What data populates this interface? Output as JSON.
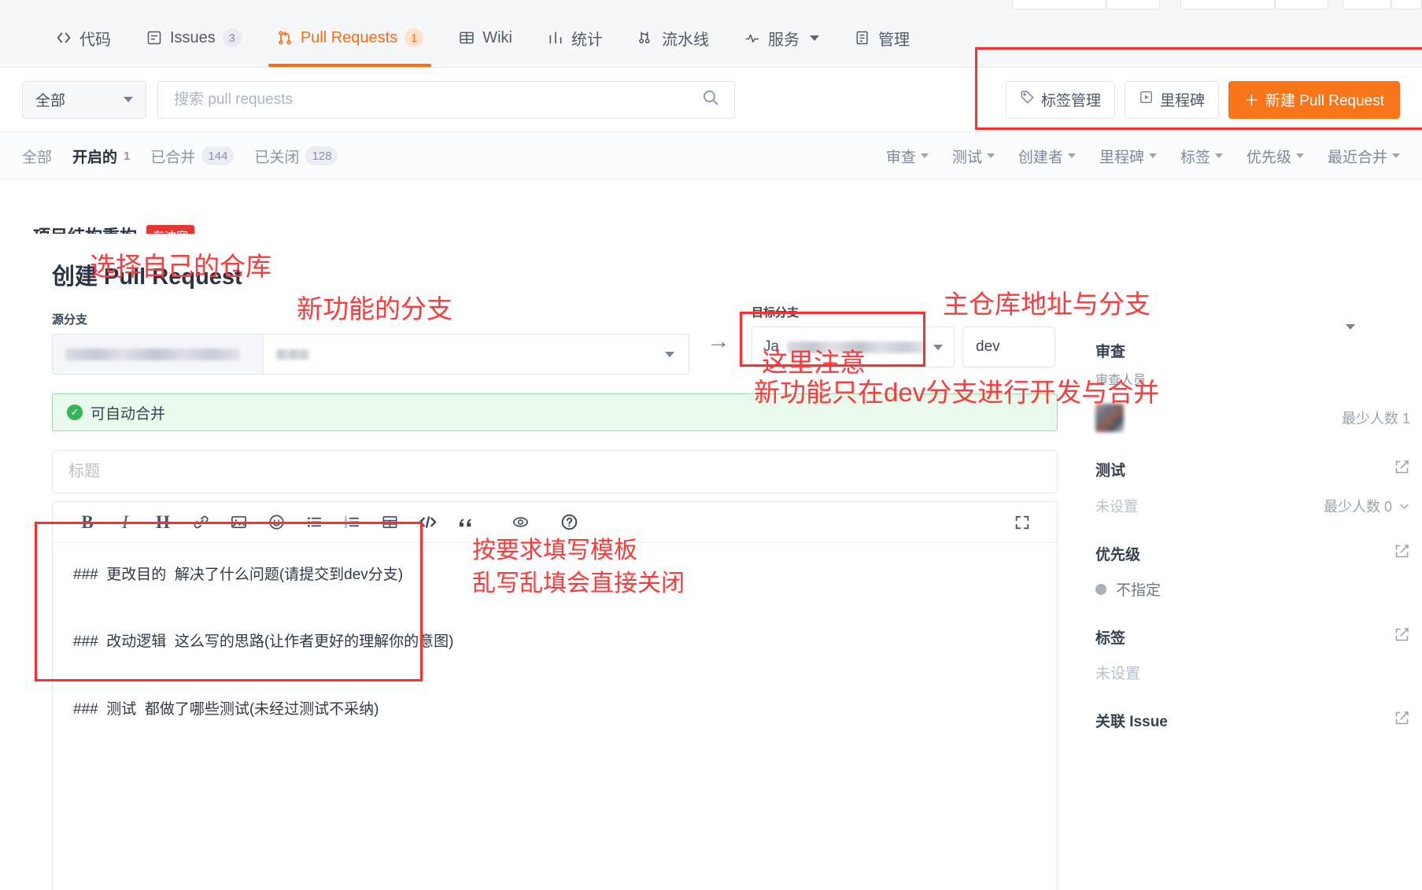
{
  "nav": {
    "items": [
      {
        "label": "代码",
        "icon": "code-icon",
        "badge": null,
        "active": false
      },
      {
        "label": "Issues",
        "icon": "issue-icon",
        "badge": "3",
        "active": false
      },
      {
        "label": "Pull Requests",
        "icon": "pull-request-icon",
        "badge": "1",
        "active": true
      },
      {
        "label": "Wiki",
        "icon": "book-icon",
        "badge": null,
        "active": false
      },
      {
        "label": "统计",
        "icon": "chart-icon",
        "badge": null,
        "active": false
      },
      {
        "label": "流水线",
        "icon": "pipeline-icon",
        "badge": null,
        "active": false
      },
      {
        "label": "服务",
        "icon": "service-icon",
        "badge": null,
        "active": false,
        "caret": true
      },
      {
        "label": "管理",
        "icon": "settings-icon",
        "badge": null,
        "active": false
      }
    ]
  },
  "toolbar": {
    "scope_label": "全部",
    "search_placeholder": "搜索 pull requests",
    "search_value": "",
    "search_icon": "search-icon",
    "label_manage": "标签管理",
    "milestone": "里程碑",
    "new_pr": "新建 Pull Request",
    "new_pr_plus": "＋"
  },
  "filters": {
    "states": [
      {
        "label": "全部",
        "count": "",
        "strong": false,
        "pill": false
      },
      {
        "label": "开启的",
        "count": "1",
        "strong": true,
        "pill": false
      },
      {
        "label": "已合并",
        "count": "144",
        "strong": false,
        "pill": true
      },
      {
        "label": "已关闭",
        "count": "128",
        "strong": false,
        "pill": true
      }
    ],
    "dropdowns": [
      "审查",
      "测试",
      "创建者",
      "里程碑",
      "标签",
      "优先级",
      "最近合并"
    ]
  },
  "background_list_item": {
    "title": "项目结构重构",
    "badge": "有冲突"
  },
  "panel": {
    "title": "创建 Pull Request",
    "source_label": "源分支",
    "target_label": "目标分支",
    "source_repo_redacted": true,
    "source_branch_redacted": true,
    "target_repo_prefix": "Ja",
    "target_repo_redacted": true,
    "target_branch": "dev",
    "merge_status": "可自动合并",
    "merge_status_icon": "check-circle-icon",
    "title_placeholder": "标题",
    "title_value": ""
  },
  "editor": {
    "toolbar_icons": [
      {
        "name": "bold-icon",
        "glyph": "B"
      },
      {
        "name": "italic-icon",
        "glyph": "I"
      },
      {
        "name": "heading-icon",
        "glyph": "H"
      },
      {
        "name": "link-icon",
        "glyph": "🔗"
      },
      {
        "name": "image-icon",
        "glyph": "🖼"
      },
      {
        "name": "emoji-icon",
        "glyph": "☺"
      },
      {
        "name": "unordered-list-icon",
        "glyph": "☰"
      },
      {
        "name": "ordered-list-icon",
        "glyph": "≣"
      },
      {
        "name": "table-icon",
        "glyph": "▦"
      },
      {
        "name": "code-block-icon",
        "glyph": "</>"
      },
      {
        "name": "quote-icon",
        "glyph": "❝"
      },
      {
        "name": "preview-eye-icon",
        "glyph": "◉"
      },
      {
        "name": "help-icon",
        "glyph": "?"
      },
      {
        "name": "fullscreen-icon",
        "glyph": "⛶"
      }
    ],
    "body_lines": [
      "###  更改目的  解决了什么问题(请提交到dev分支)",
      "###  改动逻辑  这么写的思路(让作者更好的理解你的意图)",
      "###  测试  都做了哪些测试(未经过测试不采纳)"
    ]
  },
  "sidebar": {
    "review": {
      "title": "审查",
      "subtitle": "审查人员",
      "min_count": "最少人数 1"
    },
    "test": {
      "title": "测试",
      "value": "未设置",
      "min_count": "最少人数 0"
    },
    "priority": {
      "title": "优先级",
      "value": "不指定"
    },
    "label": {
      "title": "标签",
      "value": "未设置"
    },
    "issue": {
      "title": "关联 Issue"
    },
    "edit_icon": "pencil-square-icon"
  },
  "annotations": [
    {
      "name": "annotation-choose-own-repo",
      "text": "选择自己的仓库"
    },
    {
      "name": "annotation-feature-branch",
      "text": "新功能的分支"
    },
    {
      "name": "annotation-main-repo-and-branch",
      "text": "主仓库地址与分支"
    },
    {
      "name": "annotation-note-here",
      "text": "这里注意"
    },
    {
      "name": "annotation-dev-only",
      "text": "新功能只在dev分支进行开发与合并"
    },
    {
      "name": "annotation-fill-template",
      "text": "按要求填写模板"
    },
    {
      "name": "annotation-no-garbage",
      "text": "乱写乱填会直接关闭"
    }
  ],
  "colors": {
    "accent_orange": "#f87519",
    "annotation_red": "#fb3b3b",
    "merge_green_bg": "#e9f9ec",
    "merge_green_border": "#9fdcab",
    "conflict_badge": "#e8332f"
  }
}
